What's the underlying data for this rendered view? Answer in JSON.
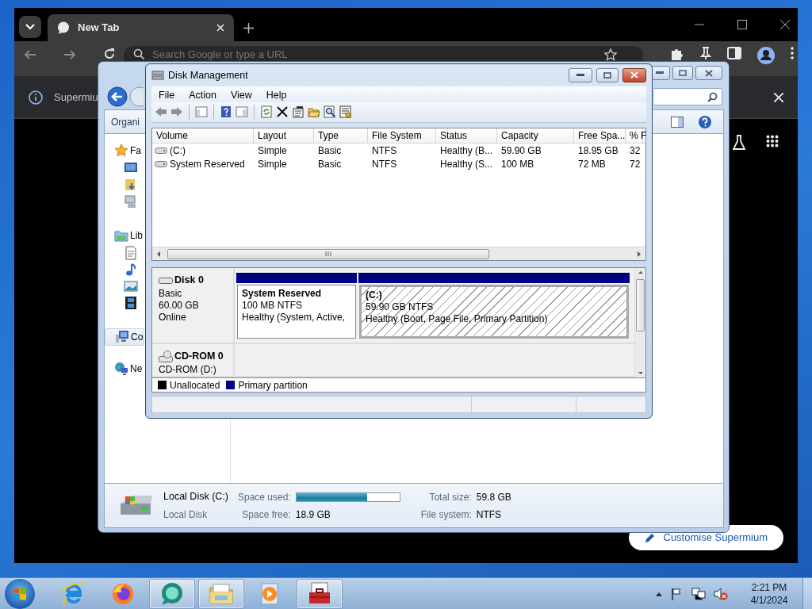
{
  "browser": {
    "tabs": [
      {
        "label": "New Tab",
        "selected": true
      }
    ],
    "omnibox": {
      "placeholder": "Search Google or type a URL"
    },
    "infobar": {
      "text": "Supermiu"
    },
    "customise_button": "Customise Supermium"
  },
  "explorer": {
    "toolbar_label": "Organi",
    "nav": [
      {
        "label": "Fa",
        "selected": false
      },
      {
        "label": "Lib",
        "selected": false
      },
      {
        "label": "Co",
        "selected": true
      },
      {
        "label": "Ne",
        "selected": false
      }
    ],
    "details": {
      "name": "Local Disk (C:)",
      "type": "Local Disk",
      "fields": [
        {
          "kind": "bar",
          "label": "Space used:",
          "level": 0.69
        },
        {
          "kind": "text",
          "label": "Total size:",
          "value": "59.8 GB"
        },
        {
          "kind": "text",
          "label": "Space free:",
          "value": "18.9 GB"
        },
        {
          "kind": "text",
          "label": "File system:",
          "value": "NTFS"
        }
      ]
    }
  },
  "disk_management": {
    "title": "Disk Management",
    "menu": [
      "File",
      "Action",
      "View",
      "Help"
    ],
    "columns": [
      "Volume",
      "Layout",
      "Type",
      "File System",
      "Status",
      "Capacity",
      "Free Spa...",
      "% F"
    ],
    "rows": [
      [
        "(C:)",
        "Simple",
        "Basic",
        "NTFS",
        "Healthy (B...",
        "59.90 GB",
        "18.95 GB",
        "32"
      ],
      [
        "System Reserved",
        "Simple",
        "Basic",
        "NTFS",
        "Healthy (S...",
        "100 MB",
        "72 MB",
        "72"
      ]
    ],
    "disks": [
      {
        "name": "Disk 0",
        "kind": "disk",
        "lines": [
          "Basic",
          "60.00 GB",
          "Online"
        ],
        "partitions": [
          {
            "name": "System Reserved",
            "size": "100 MB NTFS",
            "status": "Healthy (System, Active,",
            "selected": false
          },
          {
            "name": "(C:)",
            "size": "59.90 GB NTFS",
            "status": "Healthy (Boot, Page File, Primary Partition)",
            "selected": true
          }
        ]
      },
      {
        "name": "CD-ROM 0",
        "kind": "cdrom",
        "lines": [
          "CD-ROM (D:)"
        ]
      }
    ],
    "legend": [
      {
        "label": "Unallocated",
        "color": "#000000"
      },
      {
        "label": "Primary partition",
        "color": "#000080"
      }
    ]
  },
  "taskbar": {
    "apps": [
      {
        "kind": "ie",
        "active": false
      },
      {
        "kind": "firefox",
        "active": false
      },
      {
        "kind": "chat",
        "active": true
      },
      {
        "kind": "folder",
        "active": true
      },
      {
        "kind": "media",
        "active": false
      },
      {
        "kind": "toolbox",
        "active": true
      }
    ],
    "clock": {
      "time": "2:21 PM",
      "date": "4/1/2024"
    }
  }
}
